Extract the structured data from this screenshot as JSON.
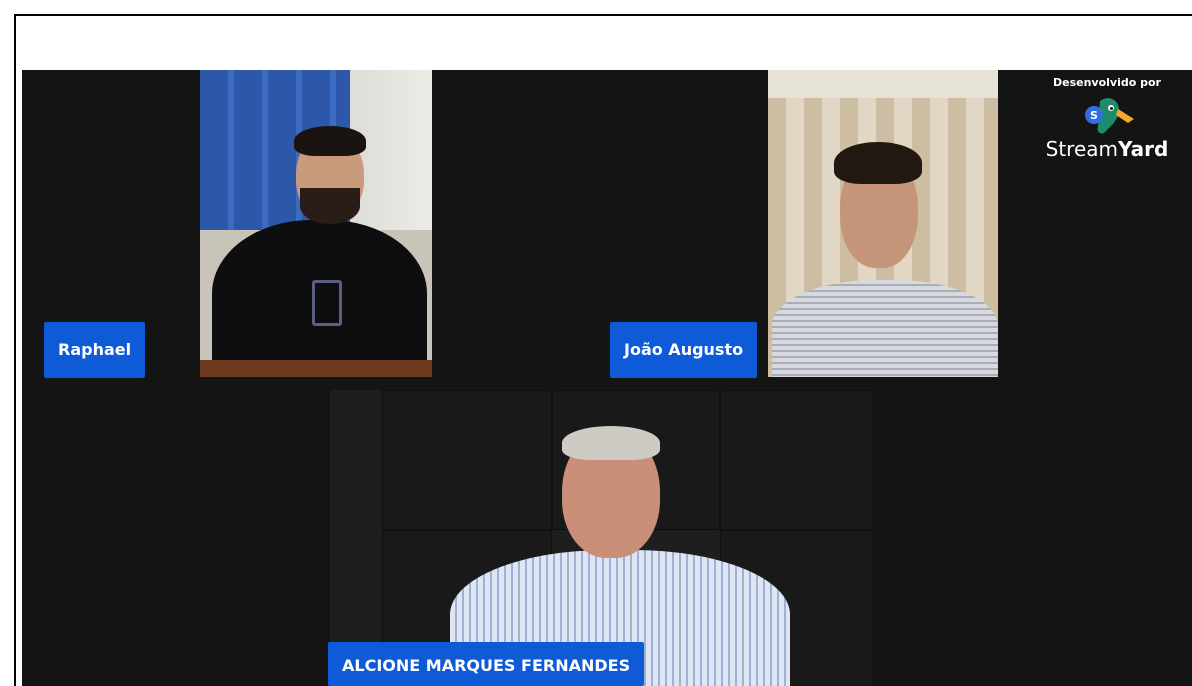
{
  "participants": {
    "raphael": {
      "name": "Raphael"
    },
    "joao": {
      "name": "João Augusto"
    },
    "alcione": {
      "name": "ALCIONE MARQUES FERNANDES"
    }
  },
  "branding": {
    "developed_by": "Desenvolvido por",
    "brand_light": "Stream",
    "brand_bold": "Yard",
    "logo_icon": "streamyard-duck-icon"
  },
  "colors": {
    "stage_background": "#141414",
    "name_tag": "#0f5ad6",
    "name_tag_text": "#ffffff"
  }
}
